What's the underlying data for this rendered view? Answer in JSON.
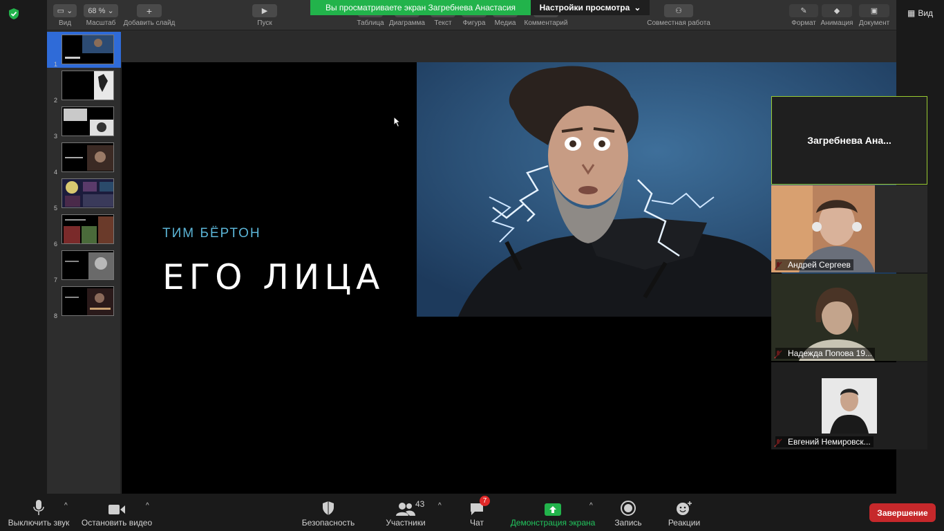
{
  "toolbar": {
    "view": "Вид",
    "zoom_value": "68 %",
    "zoom": "Масштаб",
    "add_slide": "Добавить слайд",
    "play": "Пуск",
    "table": "Таблица",
    "chart": "Диаграмма",
    "text": "Текст",
    "shape": "Фигура",
    "media": "Медиа",
    "comment": "Комментарий",
    "collab": "Совместная работа",
    "format": "Формат",
    "animation": "Анимация",
    "document": "Документ"
  },
  "share": {
    "banner": "Вы просматриваете экран Загребнева Анастасия",
    "view_settings": "Настройки просмотра",
    "right_view": "Вид"
  },
  "navigator": {
    "slides": [
      "1",
      "2",
      "3",
      "4",
      "5",
      "6",
      "7",
      "8"
    ],
    "selected": 1
  },
  "slide": {
    "subtitle": "ТИМ БЁРТОН",
    "title": "ЕГО ЛИЦА"
  },
  "participants": [
    {
      "name": "Загребнева  Ана..."
    },
    {
      "name": "Андрей Сергеев"
    },
    {
      "name": "Надежда Попова 19..."
    },
    {
      "name": "Евгений Немировск..."
    }
  ],
  "bottom": {
    "mute": "Выключить звук",
    "stop_video": "Остановить видео",
    "security": "Безопасность",
    "participants_count": "43",
    "participants": "Участники",
    "chat_badge": "7",
    "chat": "Чат",
    "share_screen": "Демонстрация экрана",
    "record": "Запись",
    "reactions": "Реакции",
    "end": "Завершение"
  },
  "colors": {
    "share_green": "#22b34b",
    "end_red": "#c6282b",
    "selected_blue": "#2f6bd8",
    "subtitle_blue": "#5bb4d6"
  }
}
